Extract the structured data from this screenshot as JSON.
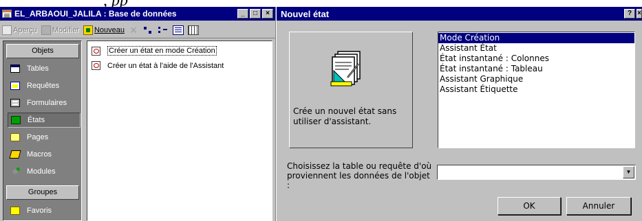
{
  "left_window": {
    "title": "EL_ARBAOUI_JALILA : Base de données",
    "toolbar": {
      "apercu": "Aperçu",
      "modifier": "Modifier",
      "nouveau": "Nouveau"
    },
    "sidebar": {
      "objects_label": "Objets",
      "items": [
        {
          "label": "Tables",
          "icon": "table-icon"
        },
        {
          "label": "Requêtes",
          "icon": "query-icon"
        },
        {
          "label": "Formulaires",
          "icon": "form-icon"
        },
        {
          "label": "États",
          "icon": "report-icon"
        },
        {
          "label": "Pages",
          "icon": "page-icon"
        },
        {
          "label": "Macros",
          "icon": "macro-icon"
        },
        {
          "label": "Modules",
          "icon": "module-icon"
        }
      ],
      "active_item": "États",
      "groups_label": "Groupes",
      "favorites_label": "Favoris"
    },
    "list_items": [
      "Créer un état en mode Création",
      "Créer un état à l'aide de l'Assistant"
    ]
  },
  "dialog": {
    "title": "Nouvel état",
    "help_button": "?",
    "close_button": "×",
    "description": "Crée un nouvel état sans utiliser d'assistant.",
    "report_types": [
      "Mode Création",
      "Assistant État",
      "État instantané : Colonnes",
      "État instantané : Tableau",
      "Assistant Graphique",
      "Assistant Étiquette"
    ],
    "selected_type": "Mode Création",
    "source_label": "Choisissez la table ou requête d'où proviennent les données de l'objet :",
    "source_value": "",
    "ok_label": "OK",
    "cancel_label": "Annuler"
  },
  "window_buttons": {
    "minimize": "_",
    "maximize": "□",
    "close": "×"
  },
  "above_text": ", pp"
}
